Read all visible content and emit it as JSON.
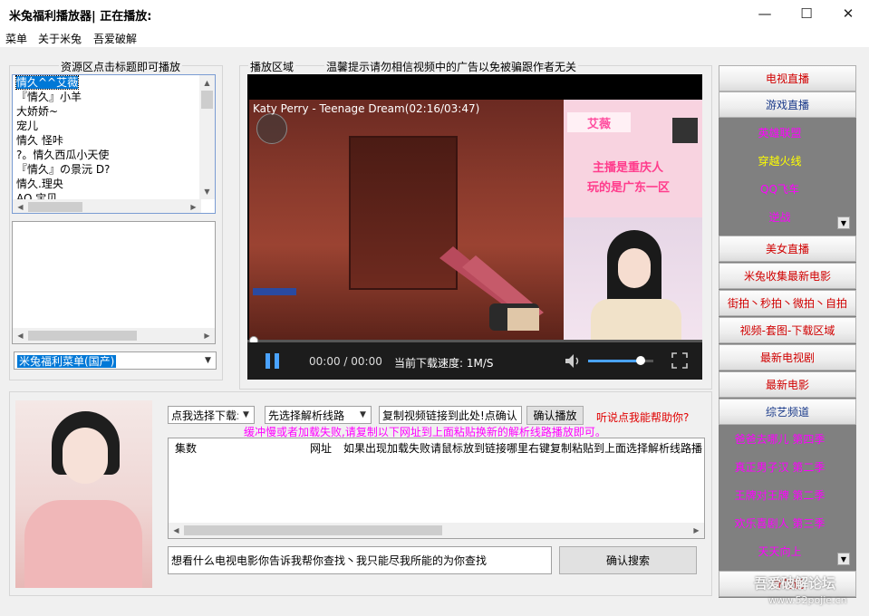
{
  "window": {
    "title": "米兔福利播放器| 正在播放:",
    "minimize_glyph": "—",
    "maximize_glyph": "☐",
    "close_glyph": "✕"
  },
  "menu": [
    "菜单",
    "关于米兔",
    "吾爱破解"
  ],
  "resource": {
    "label": "资源区点击标题即可播放",
    "items": [
      "情久^^艾薇",
      "『情久』小羊",
      "大娇娇~",
      "宠儿",
      "情久 怪咔",
      "?。情久西瓜小天使",
      "『情久』の景沅 D?",
      "情久.理央",
      "AQ 宝贝"
    ],
    "selected_index": 0,
    "category": "米兔福利菜单(国产)"
  },
  "player": {
    "area_label": "播放区域",
    "warning": "温馨提示请勿相信视频中的广告以免被骗跟作者无关",
    "overlay_title": "Katy Perry - Teenage Dream(02:16/03:47)",
    "streamer_name": "艾薇",
    "stream_text_1": "主播是重庆人",
    "stream_text_2": "玩的是广东一区",
    "time": "00:00 / 00:00",
    "speed": "当前下载速度: 1M/S",
    "volume_level": 0.8,
    "progress": 0.0
  },
  "download": {
    "select_label": "点我选择下载:",
    "line_label": "先选择解析线路",
    "link_input": "复制视频链接到此处!点确认",
    "confirm_play": "确认播放",
    "help": "听说点我能帮助你?",
    "tip": "缓冲慢或者加载失败,请复制以下网址到上面粘贴换新的解析线路播放即可。",
    "columns": [
      "集数",
      "网址",
      "如果出现加载失败请鼠标放到链接哪里右键复制粘贴到上面选择解析线路播"
    ]
  },
  "search": {
    "placeholder": "想看什么电视电影你告诉我帮你查找丶我只能尽我所能的为你查找",
    "button": "确认搜索"
  },
  "right_panel": {
    "tv": "电视直播",
    "game": "游戏直播",
    "game_items": [
      "英雄联盟",
      "穿越火线",
      "QQ飞车",
      "逆战"
    ],
    "beauty": "美女直播",
    "new_movies_collect": "米兔收集最新电影",
    "street": "街拍丶秒拍丶微拍丶自拍",
    "video_download": "视频-套图-下载区域",
    "tv_series": "最新电视剧",
    "movies": "最新电影",
    "variety": "综艺频道",
    "variety_items": [
      "爸爸去哪儿 第四季",
      "真正男子汉 第二季",
      "王牌对王牌 第二季",
      "欢乐喜剧人 第三季",
      "天天向上"
    ],
    "last": "奇葩说"
  },
  "watermark": {
    "line1": "吾爱破解论坛",
    "line2": "www.52pojie.cn"
  },
  "colors": {
    "selection": "#0078d7",
    "red_text": "#d00000",
    "magenta_text": "#ff00ff",
    "yellow_text": "#ffff00",
    "panel_gray": "#808080"
  }
}
